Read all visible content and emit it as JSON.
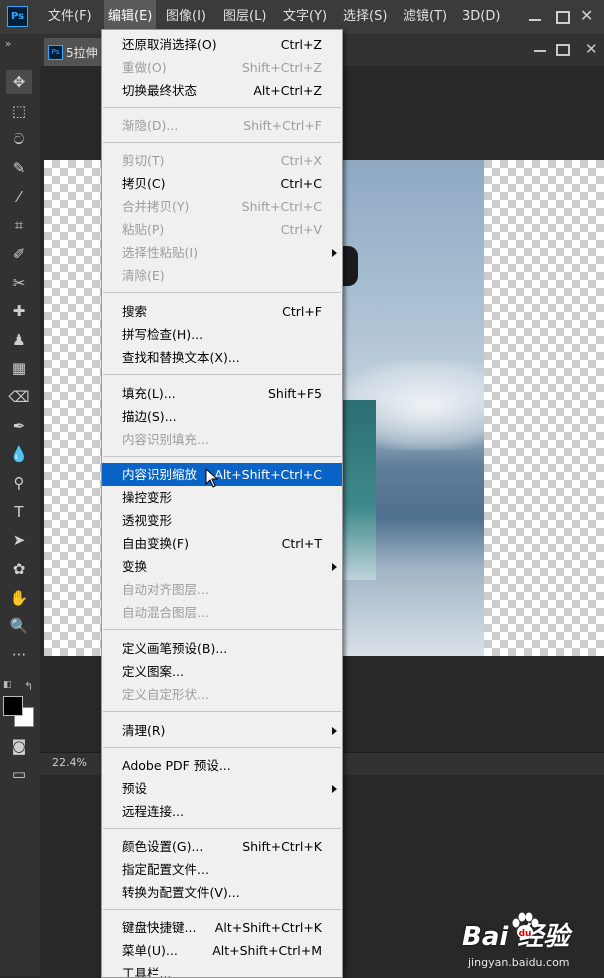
{
  "menubar": {
    "items": [
      "文件(F)",
      "编辑(E)",
      "图像(I)",
      "图层(L)",
      "文字(Y)",
      "选择(S)",
      "滤镜(T)",
      "3D(D)"
    ],
    "active_index": 1
  },
  "app_logo": "Ps",
  "document": {
    "tab_label": "5拉伸",
    "zoom": "22.4%"
  },
  "edit_menu": {
    "items": [
      {
        "label": "还原取消选择(O)",
        "shortcut": "Ctrl+Z",
        "enabled": true
      },
      {
        "label": "重做(O)",
        "shortcut": "Shift+Ctrl+Z",
        "enabled": false
      },
      {
        "label": "切换最终状态",
        "shortcut": "Alt+Ctrl+Z",
        "enabled": true
      },
      {
        "label": "渐隐(D)...",
        "shortcut": "Shift+Ctrl+F",
        "enabled": false
      },
      {
        "label": "剪切(T)",
        "shortcut": "Ctrl+X",
        "enabled": false
      },
      {
        "label": "拷贝(C)",
        "shortcut": "Ctrl+C",
        "enabled": true
      },
      {
        "label": "合并拷贝(Y)",
        "shortcut": "Shift+Ctrl+C",
        "enabled": false
      },
      {
        "label": "粘贴(P)",
        "shortcut": "Ctrl+V",
        "enabled": false
      },
      {
        "label": "选择性粘贴(I)",
        "shortcut": "",
        "enabled": false,
        "submenu": true
      },
      {
        "label": "清除(E)",
        "shortcut": "",
        "enabled": false
      },
      {
        "label": "搜索",
        "shortcut": "Ctrl+F",
        "enabled": true
      },
      {
        "label": "拼写检查(H)...",
        "shortcut": "",
        "enabled": true
      },
      {
        "label": "查找和替换文本(X)...",
        "shortcut": "",
        "enabled": true
      },
      {
        "label": "填充(L)...",
        "shortcut": "Shift+F5",
        "enabled": true
      },
      {
        "label": "描边(S)...",
        "shortcut": "",
        "enabled": true
      },
      {
        "label": "内容识别填充...",
        "shortcut": "",
        "enabled": false
      },
      {
        "label": "内容识别缩放",
        "shortcut": "Alt+Shift+Ctrl+C",
        "enabled": true,
        "highlighted": true
      },
      {
        "label": "操控变形",
        "shortcut": "",
        "enabled": true
      },
      {
        "label": "透视变形",
        "shortcut": "",
        "enabled": true
      },
      {
        "label": "自由变换(F)",
        "shortcut": "Ctrl+T",
        "enabled": true
      },
      {
        "label": "变换",
        "shortcut": "",
        "enabled": true,
        "submenu": true
      },
      {
        "label": "自动对齐图层...",
        "shortcut": "",
        "enabled": false
      },
      {
        "label": "自动混合图层...",
        "shortcut": "",
        "enabled": false
      },
      {
        "label": "定义画笔预设(B)...",
        "shortcut": "",
        "enabled": true
      },
      {
        "label": "定义图案...",
        "shortcut": "",
        "enabled": true
      },
      {
        "label": "定义自定形状...",
        "shortcut": "",
        "enabled": false
      },
      {
        "label": "清理(R)",
        "shortcut": "",
        "enabled": true,
        "submenu": true
      },
      {
        "label": "Adobe PDF 预设...",
        "shortcut": "",
        "enabled": true
      },
      {
        "label": "预设",
        "shortcut": "",
        "enabled": true,
        "submenu": true
      },
      {
        "label": "远程连接...",
        "shortcut": "",
        "enabled": true
      },
      {
        "label": "颜色设置(G)...",
        "shortcut": "Shift+Ctrl+K",
        "enabled": true
      },
      {
        "label": "指定配置文件...",
        "shortcut": "",
        "enabled": true
      },
      {
        "label": "转换为配置文件(V)...",
        "shortcut": "",
        "enabled": true
      },
      {
        "label": "键盘快捷键...",
        "shortcut": "Alt+Shift+Ctrl+K",
        "enabled": true
      },
      {
        "label": "菜单(U)...",
        "shortcut": "Alt+Shift+Ctrl+M",
        "enabled": true
      },
      {
        "label": "工具栏...",
        "shortcut": "",
        "enabled": true
      }
    ]
  },
  "tools": [
    "move-tool",
    "marquee-tool",
    "lasso-tool",
    "quick-select-tool",
    "eyedropper-tool",
    "crop-tool",
    "brush-tool",
    "healing-brush-tool",
    "clone-stamp-tool",
    "history-brush-tool",
    "gradient-tool",
    "eraser-tool",
    "pen-tool",
    "blur-tool",
    "dodge-tool",
    "type-tool",
    "path-select-tool",
    "custom-shape-tool",
    "hand-tool",
    "zoom-tool",
    "more-tools"
  ],
  "watermark": {
    "brand": "Bai  经验",
    "url": "jingyan.baidu.com"
  },
  "colors": {
    "menu_highlight": "#0a64c8",
    "menu_background": "#f0f0f0",
    "app_background": "#282828",
    "ps_blue": "#31a8ff"
  }
}
